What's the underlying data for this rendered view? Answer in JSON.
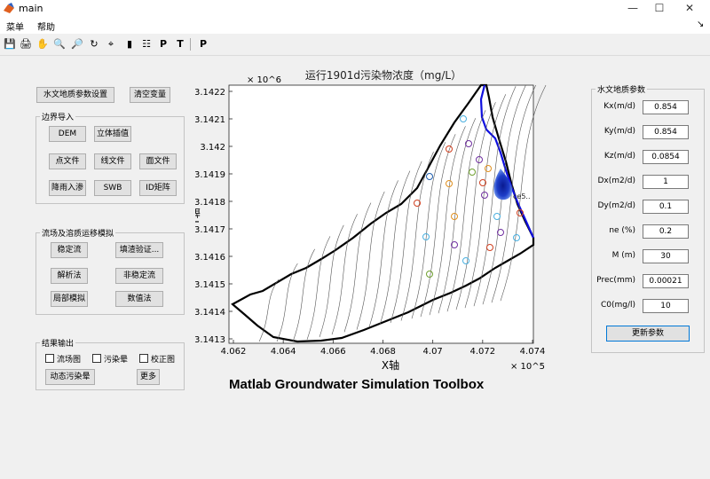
{
  "window": {
    "title": "main",
    "minimize": "—",
    "maximize": "☐",
    "close": "✕"
  },
  "menubar": {
    "items": [
      "菜单",
      "帮助"
    ],
    "arrow": "↘"
  },
  "toolbar": {
    "icons": [
      "save-icon",
      "print-icon",
      "pan-icon",
      "zoom-in-icon",
      "zoom-out-icon",
      "rotate-icon",
      "datacursor-icon",
      "colorbar-icon",
      "legend-icon",
      "p-icon",
      "t-icon",
      "p2-icon"
    ],
    "glyphs": [
      "💾",
      "🖨",
      "✋",
      "🔍",
      "🔎",
      "↻",
      "⌖",
      "▮",
      "☷",
      "P",
      "T",
      "P"
    ]
  },
  "left": {
    "hydro_button": "水文地质参数设置",
    "clear_button": "清空变量",
    "boundary": {
      "title": "边界导入",
      "buttons": [
        "DEM",
        "立体插值",
        "点文件",
        "线文件",
        "面文件",
        "降雨入渗",
        "SWB",
        "ID矩阵"
      ]
    },
    "flow": {
      "title": "流场及溶质运移模拟",
      "buttons": [
        "稳定流",
        "填渣验证...",
        "解析法",
        "非稳定流",
        "局部模拟",
        "数值法"
      ]
    },
    "output": {
      "title": "结果输出",
      "checkboxes": [
        "流场图",
        "污染晕",
        "校正图"
      ],
      "animate_button": "动态污染晕",
      "more_button": "更多"
    }
  },
  "params": {
    "title": "水文地质参数",
    "rows": [
      {
        "label": "Kx(m/d)",
        "value": "0.854"
      },
      {
        "label": "Ky(m/d)",
        "value": "0.854"
      },
      {
        "label": "Kz(m/d)",
        "value": "0.0854"
      },
      {
        "label": "Dx(m2/d)",
        "value": "1"
      },
      {
        "label": "Dy(m2/d)",
        "value": "0.1"
      },
      {
        "label": "ne  (%)",
        "value": "0.2"
      },
      {
        "label": "M    (m)",
        "value": "30"
      },
      {
        "label": "Prec(mm)",
        "value": "0.00021"
      },
      {
        "label": "C0(mg/l)",
        "value": "10"
      }
    ],
    "update_button": "更新参数"
  },
  "chart_data": {
    "type": "contour",
    "title": "运行1901d污染物浓度（mg/L）",
    "xlabel": "X轴",
    "ylabel": "Y轴",
    "x_exponent": "× 10^5",
    "y_exponent": "× 10^6",
    "xlim": [
      406.02,
      407.42
    ],
    "ylim": [
      3.14128,
      3.14222
    ],
    "xticks": [
      "4.062",
      "4.064",
      "4.066",
      "4.068",
      "4.07",
      "4.072",
      "4.074"
    ],
    "yticks": [
      "3.1413",
      "3.1414",
      "3.1415",
      "3.1416",
      "3.1417",
      "3.1418",
      "3.1419",
      "3.142",
      "3.1421",
      "3.1422"
    ],
    "grid": false,
    "plume_label": "ce5..",
    "plume_color": "#1e3ec8"
  },
  "footer": {
    "text": "Matlab Groundwater Simulation Toolbox"
  }
}
